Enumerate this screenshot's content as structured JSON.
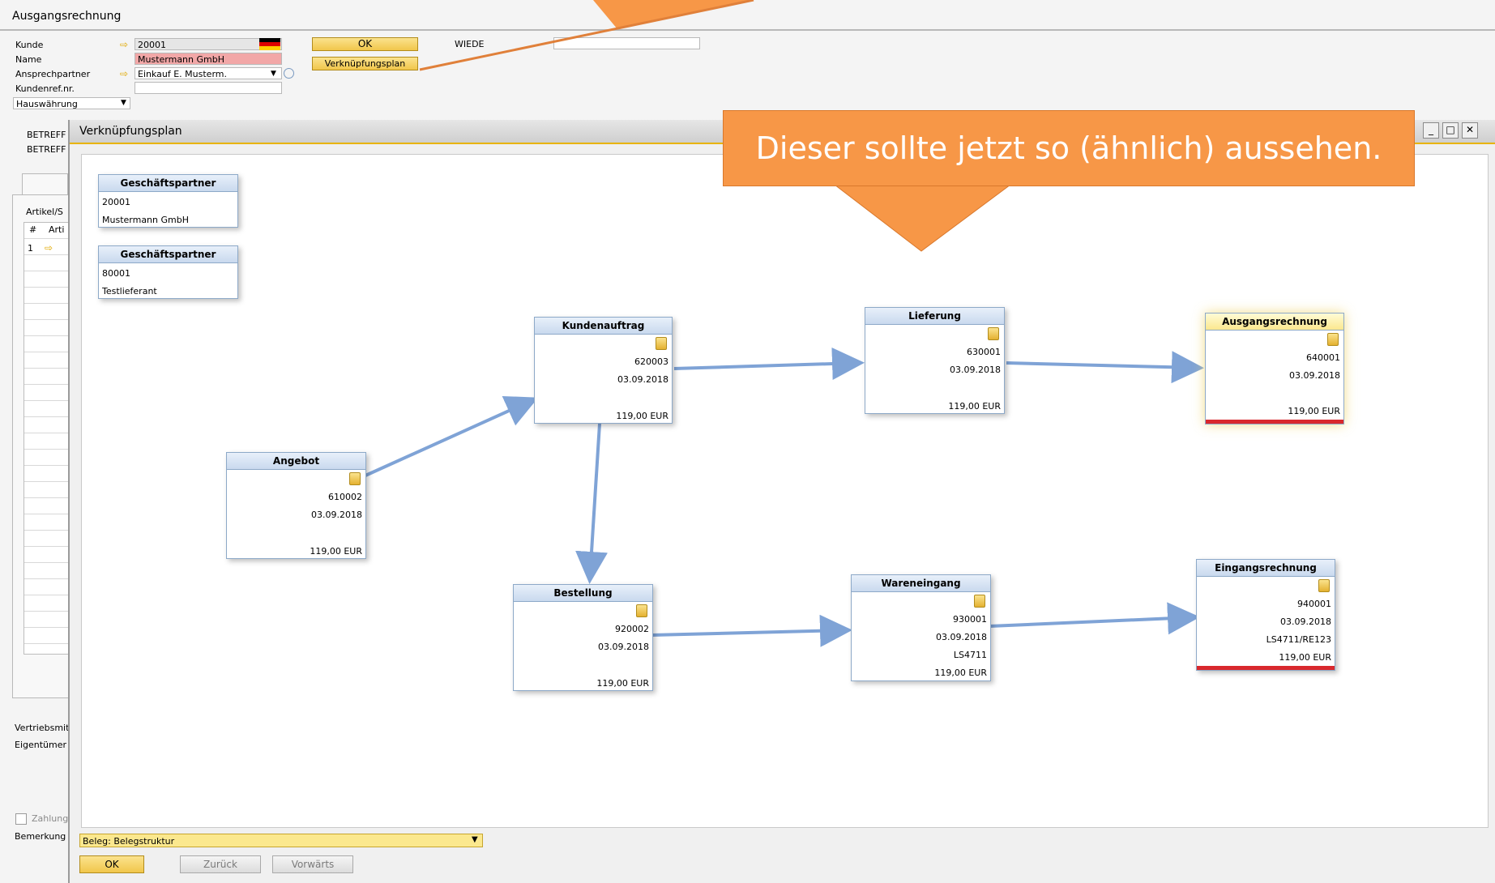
{
  "window": {
    "title": "Ausgangsrechnung",
    "fields": {
      "kunde_label": "Kunde",
      "kunde_value": "20001",
      "name_label": "Name",
      "name_value": "Mustermann GmbH",
      "ansprechpartner_label": "Ansprechpartner",
      "ansprechpartner_value": "Einkauf E. Musterm.",
      "kundenref_label": "Kundenref.nr.",
      "currency_value": "Hauswährung",
      "wiederkehrend_label": "WIEDE"
    },
    "ok_label": "OK",
    "verknuepfungsplan_button": "Verknüpfungsplan",
    "left_labels": [
      "BETREFF",
      "BETREFF",
      "Artikel/S",
      "#",
      "Arti",
      "1",
      "Vertriebsmit",
      "Eigentümer",
      "Zahlung",
      "Bemerkung"
    ]
  },
  "modal": {
    "title": "Verknüpfungsplan",
    "partners": [
      {
        "header": "Geschäftspartner",
        "code": "20001",
        "name": "Mustermann GmbH"
      },
      {
        "header": "Geschäftspartner",
        "code": "80001",
        "name": "Testlieferant"
      }
    ],
    "nodes": {
      "kundenauftrag": {
        "header": "Kundenauftrag",
        "number": "620003",
        "date": "03.09.2018",
        "amount": "119,00 EUR"
      },
      "lieferung": {
        "header": "Lieferung",
        "number": "630001",
        "date": "03.09.2018",
        "amount": "119,00 EUR"
      },
      "ausgangsrechnung": {
        "header": "Ausgangsrechnung",
        "number": "640001",
        "date": "03.09.2018",
        "amount": "119,00 EUR"
      },
      "angebot": {
        "header": "Angebot",
        "number": "610002",
        "date": "03.09.2018",
        "amount": "119,00 EUR"
      },
      "bestellung": {
        "header": "Bestellung",
        "number": "920002",
        "date": "03.09.2018",
        "amount": "119,00 EUR"
      },
      "wareneingang": {
        "header": "Wareneingang",
        "number": "930001",
        "date": "03.09.2018",
        "ref": "LS4711",
        "amount": "119,00 EUR"
      },
      "eingangsrechnung": {
        "header": "Eingangsrechnung",
        "number": "940001",
        "date": "03.09.2018",
        "ref": "LS4711/RE123",
        "amount": "119,00 EUR"
      }
    },
    "layout_select": "Beleg: Belegstruktur",
    "buttons": {
      "ok": "OK",
      "back": "Zurück",
      "forward": "Vorwärts"
    }
  },
  "callout": {
    "text": "Dieser sollte jetzt so (ähnlich) aussehen.",
    "color": "#f79747"
  },
  "colors": {
    "accent": "#e8b400",
    "link_arrow": "#7fa3d6",
    "error_bar": "#d9282d"
  }
}
